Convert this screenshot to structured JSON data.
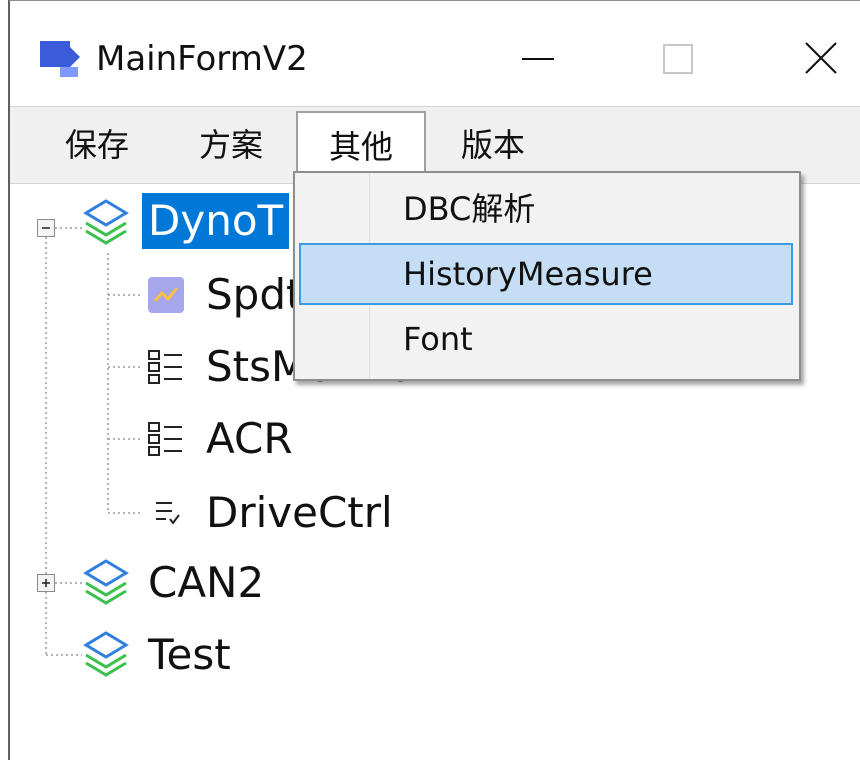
{
  "window": {
    "title": "MainFormV2"
  },
  "menubar": {
    "items": [
      {
        "label": "保存"
      },
      {
        "label": "方案"
      },
      {
        "label": "其他"
      },
      {
        "label": "版本"
      }
    ]
  },
  "dropdown": {
    "items": [
      {
        "label": "DBC解析"
      },
      {
        "label": "HistoryMeasure"
      },
      {
        "label": "Font"
      }
    ]
  },
  "tree": {
    "nodes": [
      {
        "label": "DynoT",
        "icon": "layers-icon",
        "state": "expanded",
        "selected": true
      },
      {
        "label": "Spdt",
        "icon": "chart-icon"
      },
      {
        "label": "StsMonitor",
        "icon": "list-icon"
      },
      {
        "label": "ACR",
        "icon": "list-icon"
      },
      {
        "label": "DriveCtrl",
        "icon": "list-check-icon"
      },
      {
        "label": "CAN2",
        "icon": "layers-icon",
        "state": "collapsed"
      },
      {
        "label": "Test",
        "icon": "layers-icon"
      }
    ]
  },
  "colors": {
    "selection": "#0078d7",
    "app_icon": "#3b5bdb",
    "layers_blue": "#2f7fe0",
    "layers_green": "#39c24a",
    "menu_highlight": "#c6def5",
    "menu_highlight_border": "#3c9ce0"
  }
}
